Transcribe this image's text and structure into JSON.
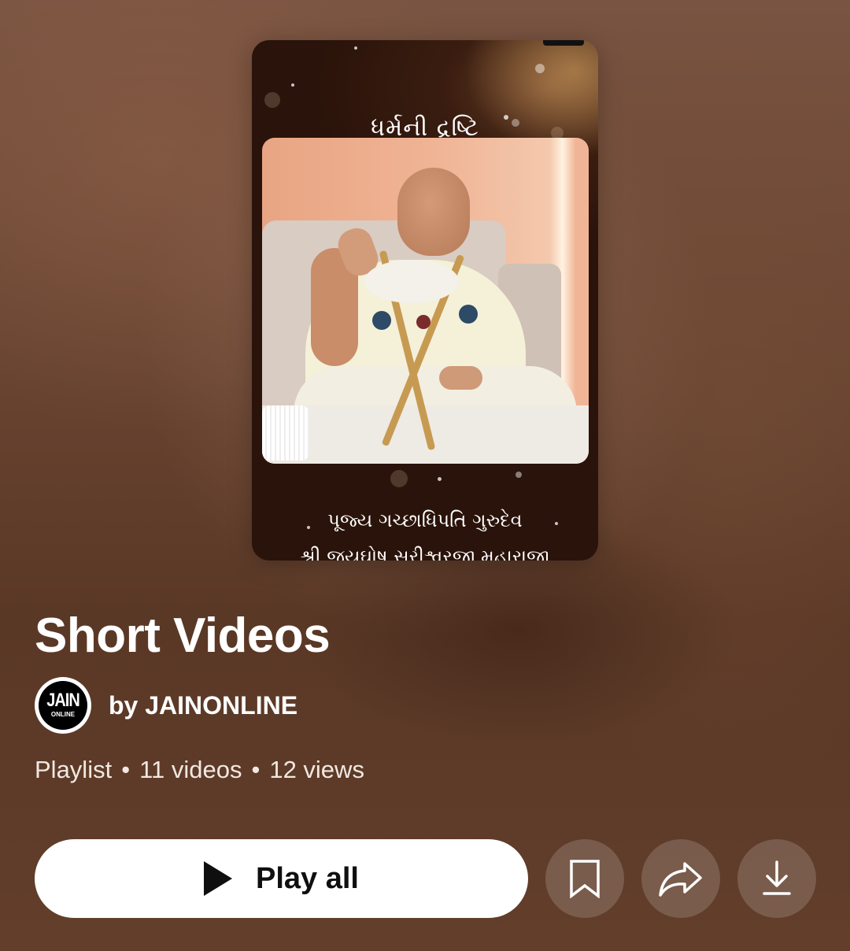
{
  "thumbnail": {
    "title_text": "ધર્મની દ્રષ્ટિ",
    "caption_line1": "પૂજ્ય ગચ્છાધિપતિ ગુરુદેવ",
    "caption_line2": "શ્રી જયઘોષ સૂરીશ્વરજી મહારાજા"
  },
  "playlist": {
    "title": "Short Videos",
    "channel": {
      "byline": "by JAINONLINE",
      "avatar_top": "JAIN",
      "avatar_bottom": "ONLINE"
    },
    "stats": {
      "type": "Playlist",
      "videos": "11 videos",
      "views": "12 views",
      "separator": "•"
    }
  },
  "actions": {
    "play_all_label": "Play all",
    "save_icon": "bookmark-icon",
    "share_icon": "share-icon",
    "download_icon": "download-icon"
  },
  "colors": {
    "background": "#5e3b28",
    "button_bg": "#ffffff",
    "text": "#ffffff"
  }
}
